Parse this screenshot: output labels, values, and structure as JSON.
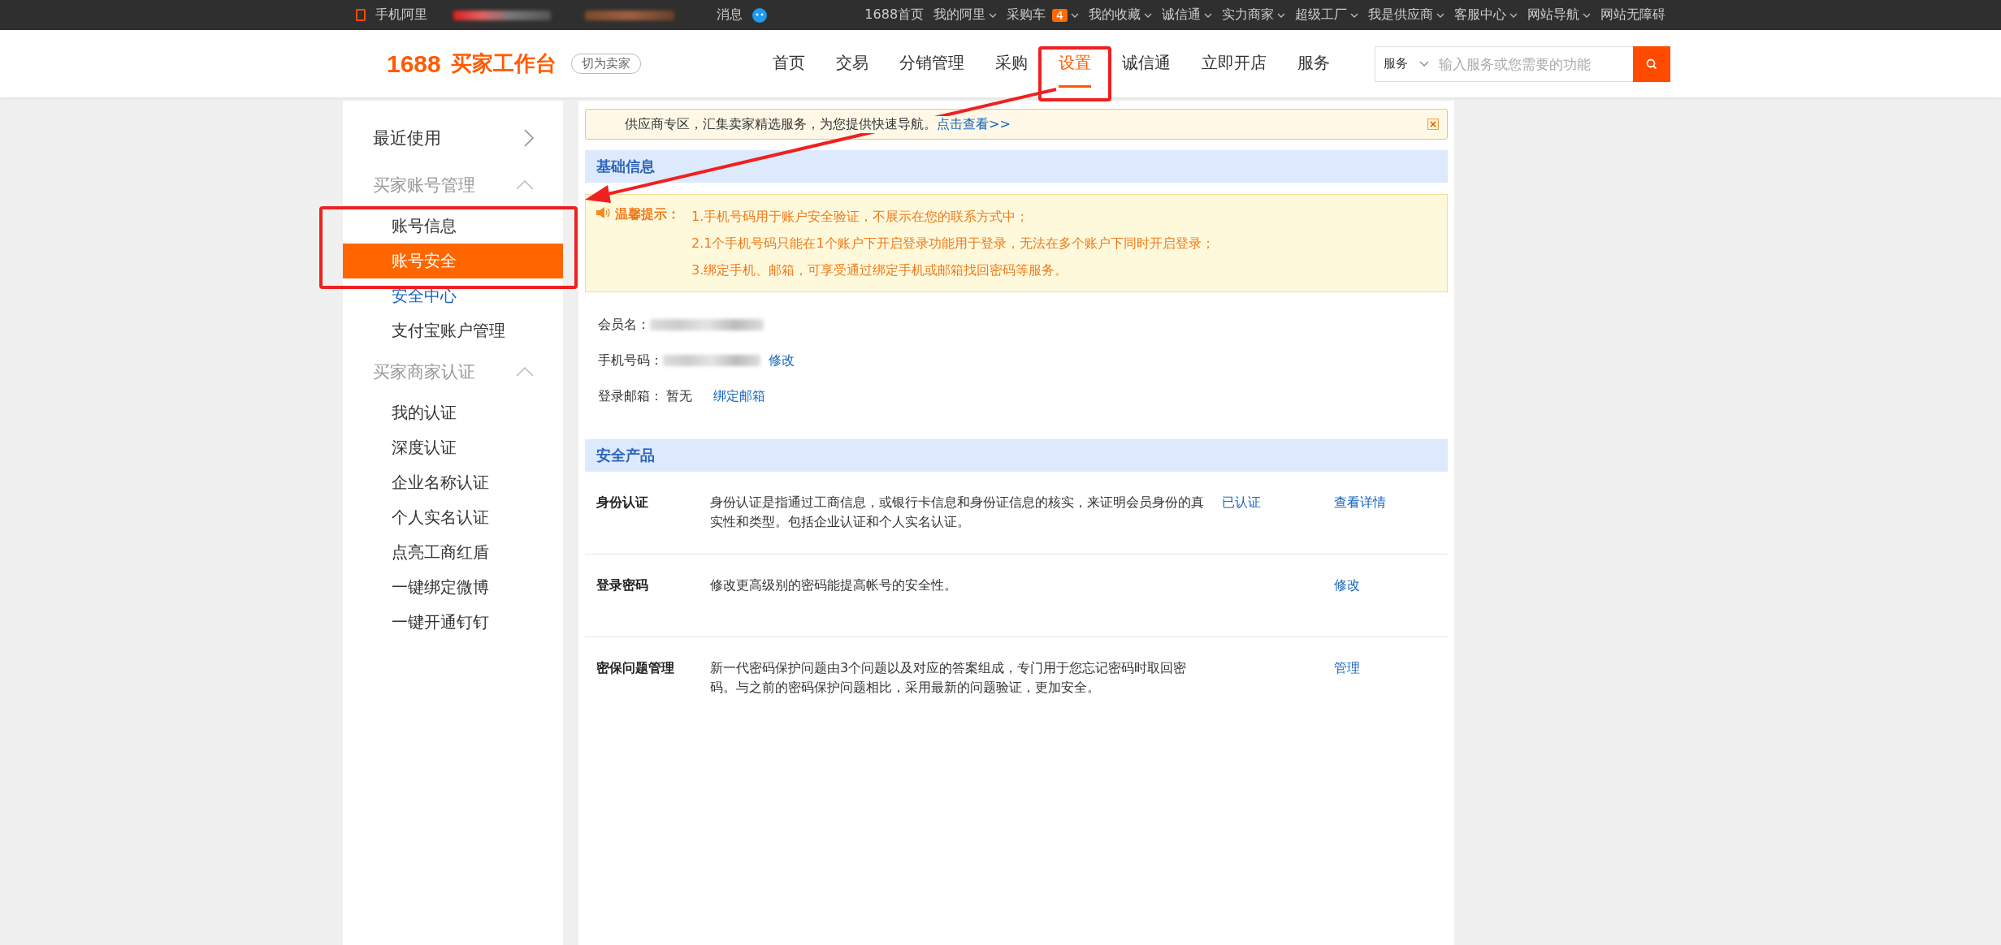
{
  "top_bar": {
    "mobile_label": "手机阿里",
    "messages_label": "消息",
    "links": [
      {
        "label": "1688首页",
        "has_dropdown": false
      },
      {
        "label": "我的阿里",
        "has_dropdown": true
      },
      {
        "label": "采购车",
        "has_dropdown": true,
        "badge": "4"
      },
      {
        "label": "我的收藏",
        "has_dropdown": true
      },
      {
        "label": "诚信通",
        "has_dropdown": true
      },
      {
        "label": "实力商家",
        "has_dropdown": true
      },
      {
        "label": "超级工厂",
        "has_dropdown": true
      },
      {
        "label": "我是供应商",
        "has_dropdown": true
      },
      {
        "label": "客服中心",
        "has_dropdown": true
      },
      {
        "label": "网站导航",
        "has_dropdown": true
      },
      {
        "label": "网站无障碍",
        "has_dropdown": false
      }
    ]
  },
  "header": {
    "logo": "1688",
    "title": "买家工作台",
    "switch_button": "切为卖家",
    "nav": [
      {
        "label": "首页",
        "selected": false
      },
      {
        "label": "交易",
        "selected": false
      },
      {
        "label": "分销管理",
        "selected": false
      },
      {
        "label": "采购",
        "selected": false
      },
      {
        "label": "设置",
        "selected": true
      },
      {
        "label": "诚信通",
        "selected": false
      },
      {
        "label": "立即开店",
        "selected": false
      },
      {
        "label": "服务",
        "selected": false
      }
    ],
    "search": {
      "scope": "服务",
      "placeholder": "输入服务或您需要的功能"
    }
  },
  "sidebar": [
    {
      "label": "最近使用",
      "expanded": false
    },
    {
      "label": "买家账号管理",
      "expanded": true,
      "items": [
        {
          "label": "账号信息",
          "kind": "item",
          "selected": false
        },
        {
          "label": "账号安全",
          "kind": "item",
          "selected": true
        },
        {
          "label": "安全中心",
          "kind": "link",
          "selected": false
        },
        {
          "label": "支付宝账户管理",
          "kind": "item",
          "selected": false
        }
      ]
    },
    {
      "label": "买家商家认证",
      "expanded": true,
      "items": [
        {
          "label": "我的认证",
          "kind": "item",
          "selected": false
        },
        {
          "label": "深度认证",
          "kind": "item",
          "selected": false
        },
        {
          "label": "企业名称认证",
          "kind": "item",
          "selected": false
        },
        {
          "label": "个人实名认证",
          "kind": "item",
          "selected": false
        },
        {
          "label": "点亮工商红盾",
          "kind": "item",
          "selected": false
        },
        {
          "label": "一键绑定微博",
          "kind": "item",
          "selected": false
        },
        {
          "label": "一键开通钉钉",
          "kind": "item",
          "selected": false
        }
      ]
    }
  ],
  "notice": {
    "text": "供应商专区，汇集卖家精选服务，为您提供快速导航。",
    "link": "点击查看>>"
  },
  "basic_info": {
    "title": "基础信息",
    "tip_label": "温馨提示：",
    "tips": [
      "1.手机号码用于账户安全验证，不展示在您的联系方式中；",
      "2.1个手机号码只能在1个账户下开启登录功能用于登录，无法在多个账户下同时开启登录；",
      "3.绑定手机、邮箱，可享受通过绑定手机或邮箱找回密码等服务。"
    ],
    "fields": [
      {
        "label": "会员名：",
        "kind": "blurred"
      },
      {
        "label": "手机号码：",
        "kind": "blurred",
        "action": "修改"
      },
      {
        "label": "登录邮箱：",
        "kind": "text",
        "value": "暂无",
        "action": "绑定邮箱"
      }
    ]
  },
  "security_products": {
    "title": "安全产品",
    "rows": [
      {
        "name": "身份认证",
        "description": "身份认证是指通过工商信息，或银行卡信息和身份证信息的核实，来证明会员身份的真实性和类型。包括企业认证和个人实名认证。",
        "status": "已认证",
        "action": "查看详情"
      },
      {
        "name": "登录密码",
        "description": "修改更高级别的密码能提高帐号的安全性。",
        "action": "修改"
      },
      {
        "name": "密保问题管理",
        "description": "新一代密码保护问题由3个问题以及对应的答案组成，专门用于您忘记密码时取回密码。与之前的密码保护问题相比，采用最新的问题验证，更加安全。",
        "action": "管理"
      }
    ]
  }
}
